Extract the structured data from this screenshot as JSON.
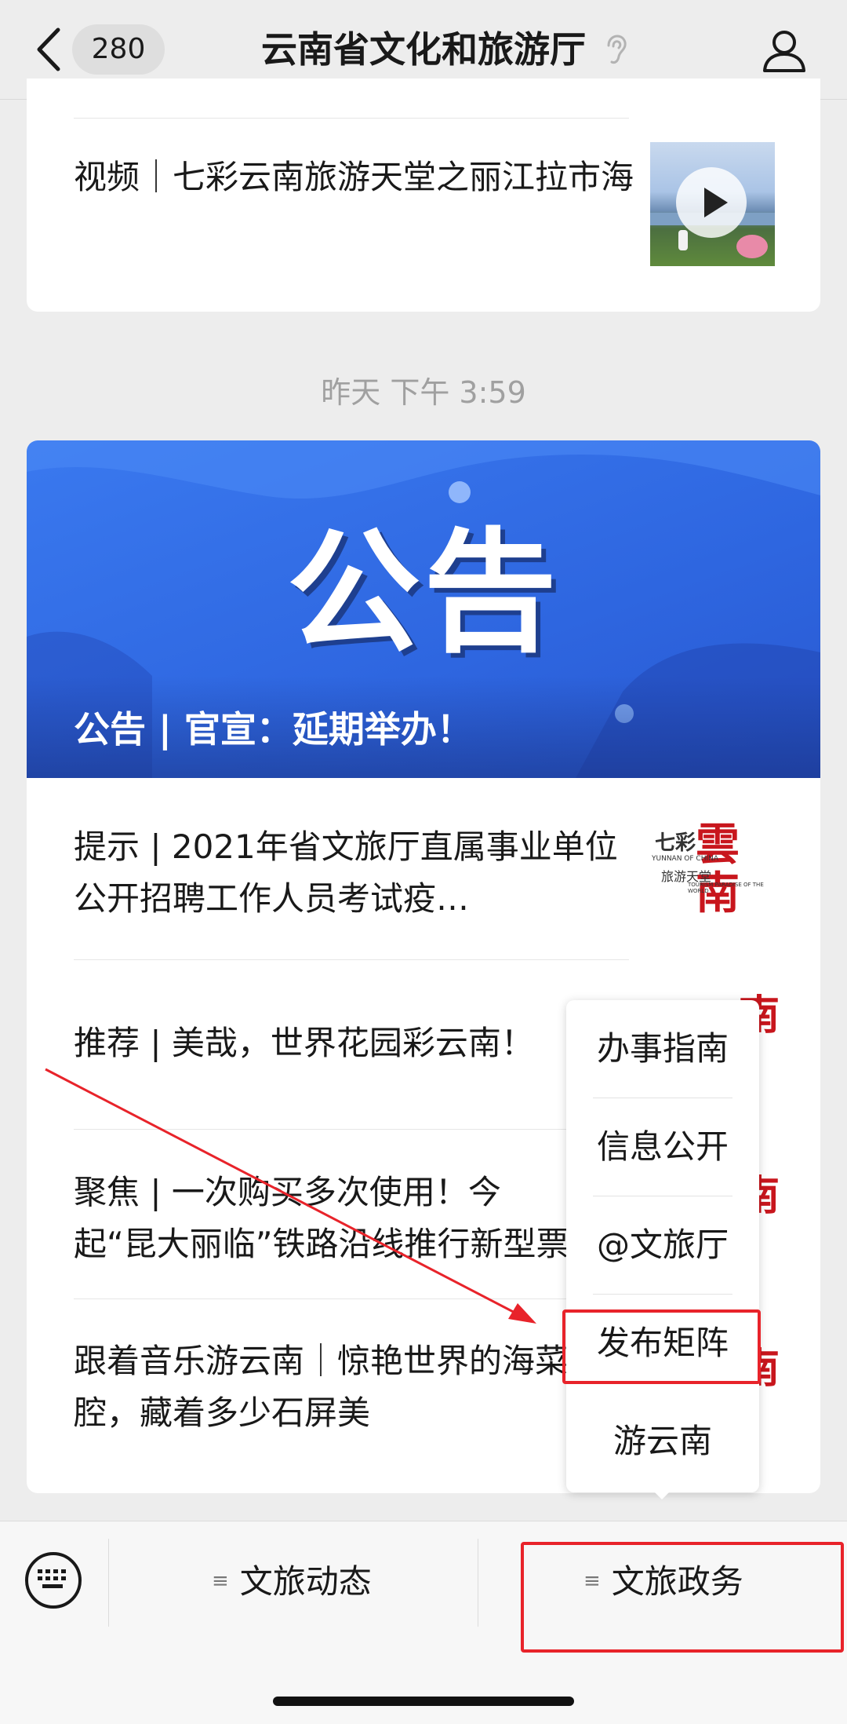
{
  "header": {
    "back_label": "",
    "unread_count": "280",
    "title": "云南省文化和旅游厅",
    "icons": [
      "back-chevron-icon",
      "ear-icon",
      "profile-icon"
    ]
  },
  "card_top": {
    "item": {
      "title": "视频｜七彩云南旅游天堂之丽江拉市海",
      "thumb_icon": "play-icon"
    }
  },
  "timestamp": "昨天 下午 3:59",
  "card_main": {
    "banner": {
      "big_text": "公告",
      "caption": "公告 | 官宣：延期举办！"
    },
    "items": [
      {
        "title": "提示 | 2021年省文旅厅直属事业单位公开招聘工作人员考试疫…"
      },
      {
        "title": "推荐 | 美哉，世界花园彩云南！"
      },
      {
        "title": "聚焦 | 一次购买多次使用！今起“昆大丽临”铁路沿线推行新型票"
      },
      {
        "title": "跟着音乐游云南｜惊艳世界的海菜腔，藏着多少石屏美"
      }
    ],
    "logo": {
      "cn_small": "七彩",
      "cn_big": "雲南",
      "en_top": "YUNNAN OF CHINA",
      "cn_tag": "旅游天堂",
      "en_bottom": "TOURISM PARADISE OF THE WORLD"
    }
  },
  "popup_menu": {
    "items": [
      "办事指南",
      "信息公开",
      "@文旅厅",
      "发布矩阵",
      "游云南"
    ],
    "highlighted": "发布矩阵"
  },
  "bottom_bar": {
    "keyboard_icon": "keyboard-icon",
    "tabs": [
      "文旅动态",
      "文旅政务"
    ],
    "tab_menu_icon": "≡",
    "highlighted_tab": "文旅政务"
  },
  "annotation_color": "#e8232a",
  "accent_blue": "#2e66e0"
}
